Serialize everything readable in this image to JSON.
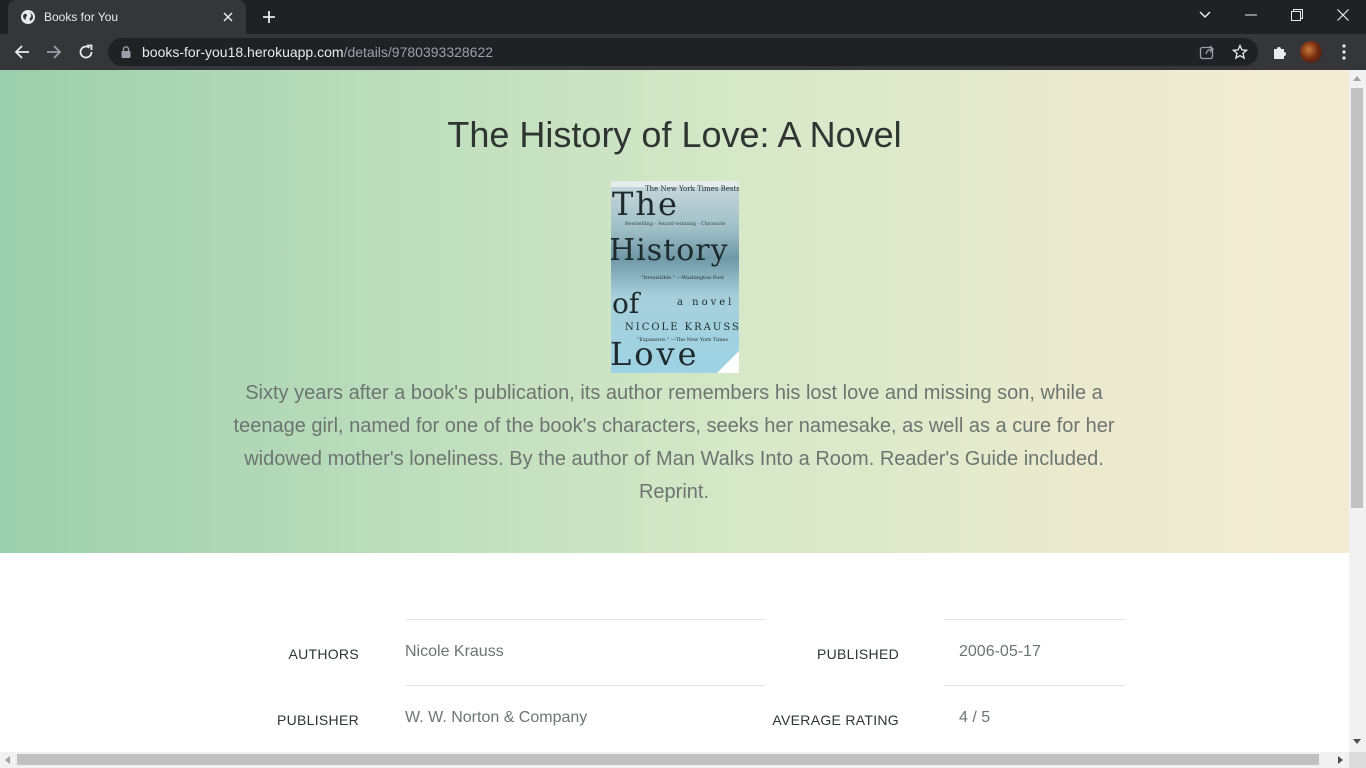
{
  "browser": {
    "tab_title": "Books for You",
    "url_host": "books-for-you18.herokuapp.com",
    "url_path": "/details/9780393328622"
  },
  "book": {
    "title": "The History of Love: A Novel",
    "cover": {
      "banner": "The New York Times Bestseller",
      "word_the": "The",
      "blurb_top": "Bestselling · Award-winning · Chronicle",
      "word_history": "History",
      "quote_1": "\"Irresistible.\" —Washington Post",
      "word_of": "of",
      "subtitle": "a novel",
      "author": "NICOLE KRAUSS",
      "quote_2": "\"Expansive.\" —The New York Times",
      "word_love": "Love"
    },
    "description": "Sixty years after a book's publication, its author remembers his lost love and missing son, while a teenage girl, named for one of the book's characters, seeks her namesake, as well as a cure for her widowed mother's loneliness. By the author of Man Walks Into a Room. Reader's Guide included. Reprint."
  },
  "details": {
    "authors_label": "AUTHORS",
    "authors_value": "Nicole Krauss",
    "published_label": "PUBLISHED",
    "published_value": "2006-05-17",
    "publisher_label": "PUBLISHER",
    "publisher_value": "W. W. Norton & Company",
    "rating_label": "AVERAGE RATING",
    "rating_value": "4 / 5"
  },
  "icons": {
    "favicon": "globe-icon",
    "close": "close-icon",
    "new_tab": "plus-icon",
    "back": "arrow-left-icon",
    "forward": "arrow-right-icon",
    "reload": "reload-icon",
    "lock": "lock-icon",
    "share": "share-icon",
    "bookmark": "star-icon",
    "extensions": "puzzle-icon",
    "menu": "kebab-menu-icon"
  },
  "colors": {
    "hero_gradient_start": "#9ccfad",
    "hero_gradient_end": "#f3ecd3",
    "title_text": "#2f3532",
    "muted_text": "#6e7471"
  }
}
